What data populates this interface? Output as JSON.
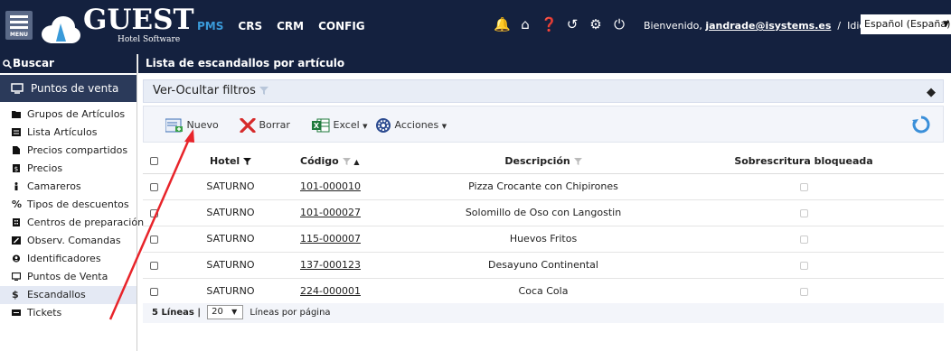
{
  "header": {
    "menu_label": "MENU",
    "logo_name": "GUEST",
    "logo_sub": "Hotel Software",
    "nav": [
      "PMS",
      "CRS",
      "CRM",
      "CONFIG"
    ],
    "welcome_prefix": "Bienvenido,",
    "user": "jandrade@isystems.es",
    "separator": "/",
    "lang_label": "Idioma",
    "lang_value": "Español (España)"
  },
  "sidebar": {
    "search_label": "Buscar",
    "section_label": "Puntos de venta",
    "items": [
      {
        "label": "Grupos de Artículos",
        "icon": "folder-icon"
      },
      {
        "label": "Lista Artículos",
        "icon": "list-icon"
      },
      {
        "label": "Precios compartidos",
        "icon": "document-icon"
      },
      {
        "label": "Precios",
        "icon": "price-tag-icon"
      },
      {
        "label": "Camareros",
        "icon": "person-icon"
      },
      {
        "label": "Tipos de descuentos",
        "icon": "percent-icon"
      },
      {
        "label": "Centros de preparación",
        "icon": "building-icon"
      },
      {
        "label": "Observ. Comandas",
        "icon": "edit-icon"
      },
      {
        "label": "Identificadores",
        "icon": "user-circle-icon"
      },
      {
        "label": "Puntos de Venta",
        "icon": "monitor-icon"
      },
      {
        "label": "Escandallos",
        "icon": "dollar-icon"
      },
      {
        "label": "Tickets",
        "icon": "ticket-icon"
      }
    ]
  },
  "content": {
    "title": "Lista de escandallos por artículo",
    "filters_label": "Ver-Ocultar filtros",
    "toolbar": {
      "new": "Nuevo",
      "delete": "Borrar",
      "excel": "Excel",
      "actions": "Acciones"
    },
    "table": {
      "headers": [
        "Hotel",
        "Código",
        "Descripción",
        "Sobrescritura bloqueada"
      ],
      "rows": [
        {
          "hotel": "SATURNO",
          "code": "101-000010",
          "desc": "Pizza Crocante con Chipirones"
        },
        {
          "hotel": "SATURNO",
          "code": "101-000027",
          "desc": "Solomillo de Oso con Langostin"
        },
        {
          "hotel": "SATURNO",
          "code": "115-000007",
          "desc": "Huevos Fritos"
        },
        {
          "hotel": "SATURNO",
          "code": "137-000123",
          "desc": "Desayuno Continental"
        },
        {
          "hotel": "SATURNO",
          "code": "224-000001",
          "desc": "Coca Cola"
        }
      ]
    },
    "pager": {
      "count": "5 Líneas |",
      "per_page_value": "20",
      "per_page_label": "Líneas por página"
    }
  },
  "colors": {
    "header_bg": "#14213f",
    "active_nav": "#3a9ad9",
    "annotation_arrow": "#e8242a"
  }
}
